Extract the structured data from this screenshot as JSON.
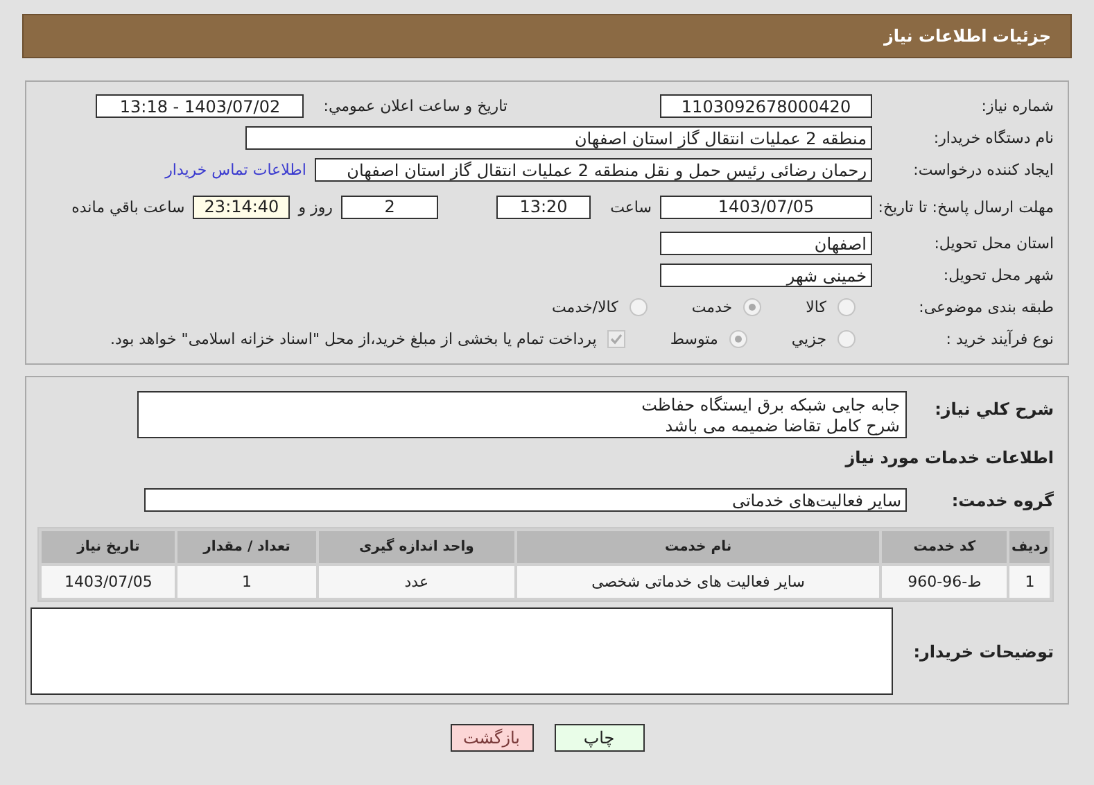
{
  "header": {
    "title": "جزئیات اطلاعات نیاز"
  },
  "details": {
    "need_number": {
      "label": "شماره نیاز:",
      "value": "1103092678000420"
    },
    "announce": {
      "label": "تاریخ و ساعت اعلان عمومي:",
      "value": "1403/07/02 - 13:18"
    },
    "buyer": {
      "label": "نام دستگاه خریدار:",
      "value": "منطقه 2 عملیات انتقال گاز استان اصفهان"
    },
    "creator": {
      "label": "ایجاد کننده درخواست:",
      "value": "رحمان رضائی رئیس حمل و نقل منطقه 2 عملیات انتقال گاز استان اصفهان",
      "link": "اطلاعات تماس خریدار"
    },
    "deadline": {
      "label": "مهلت ارسال پاسخ: تا تاریخ:",
      "date": "1403/07/05",
      "time_label": "ساعت",
      "time": "13:20",
      "days": "2",
      "days_label": "روز و",
      "remaining": "23:14:40",
      "remaining_label": "ساعت باقي مانده"
    },
    "province": {
      "label": "استان محل تحویل:",
      "value": "اصفهان"
    },
    "city": {
      "label": "شهر محل تحویل:",
      "value": "خمینی شهر"
    },
    "category": {
      "label": "طبقه بندی موضوعی:",
      "options": [
        {
          "label": "کالا",
          "selected": false
        },
        {
          "label": "خدمت",
          "selected": true
        },
        {
          "label": "کالا/خدمت",
          "selected": false
        }
      ]
    },
    "process": {
      "label": "نوع فرآیند خرید :",
      "options": [
        {
          "label": "جزیي",
          "selected": false
        },
        {
          "label": "متوسط",
          "selected": true
        }
      ],
      "treasury": {
        "checked": true,
        "text": "پرداخت تمام یا بخشی از مبلغ خرید،از محل \"اسناد خزانه اسلامی\" خواهد بود."
      }
    }
  },
  "services": {
    "description": {
      "label": "شرح کلي نیاز:",
      "lines": [
        "جابه جایی شبکه برق ایستگاه حفاظت",
        "شرح کامل تقاضا ضمیمه می باشد"
      ]
    },
    "heading": "اطلاعات خدمات مورد نیاز",
    "group": {
      "label": "گروه خدمت:",
      "value": "سایر فعالیت‌های خدماتی"
    },
    "table": {
      "columns": [
        "ردیف",
        "کد خدمت",
        "نام خدمت",
        "واحد اندازه گیری",
        "تعداد / مقدار",
        "تاریخ نیاز"
      ],
      "rows": [
        [
          "1",
          "ط-96-960",
          "سایر فعالیت های خدماتی شخصی",
          "عدد",
          "1",
          "1403/07/05"
        ]
      ]
    },
    "buyer_notes": {
      "label": "توضیحات خریدار:"
    }
  },
  "buttons": [
    {
      "kind": "print",
      "label": "چاپ"
    },
    {
      "kind": "back",
      "label": "بازگشت"
    }
  ]
}
